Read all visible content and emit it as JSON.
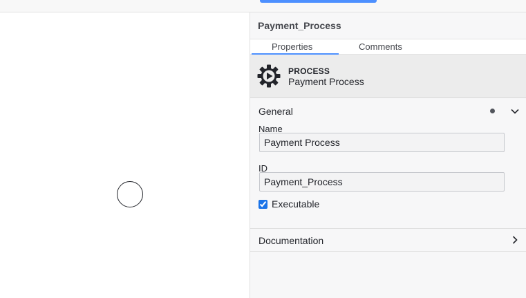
{
  "panel": {
    "header_title": "Payment_Process",
    "tabs": [
      {
        "label": "Properties",
        "active": true
      },
      {
        "label": "Comments",
        "active": false
      }
    ],
    "element": {
      "icon": "gear-play-icon",
      "type": "PROCESS",
      "name": "Payment Process"
    },
    "groups": {
      "general": {
        "title": "General",
        "expanded": true,
        "has_indicator_dot": true,
        "name_label": "Name",
        "name_value": "Payment Process",
        "id_label": "ID",
        "id_value": "Payment_Process",
        "executable_label": "Executable",
        "executable_checked": true
      },
      "documentation": {
        "title": "Documentation",
        "expanded": false
      }
    }
  },
  "colors": {
    "accent": "#4d90ff",
    "panel_bg": "#f7f7f8",
    "header_bg": "#ececec"
  }
}
